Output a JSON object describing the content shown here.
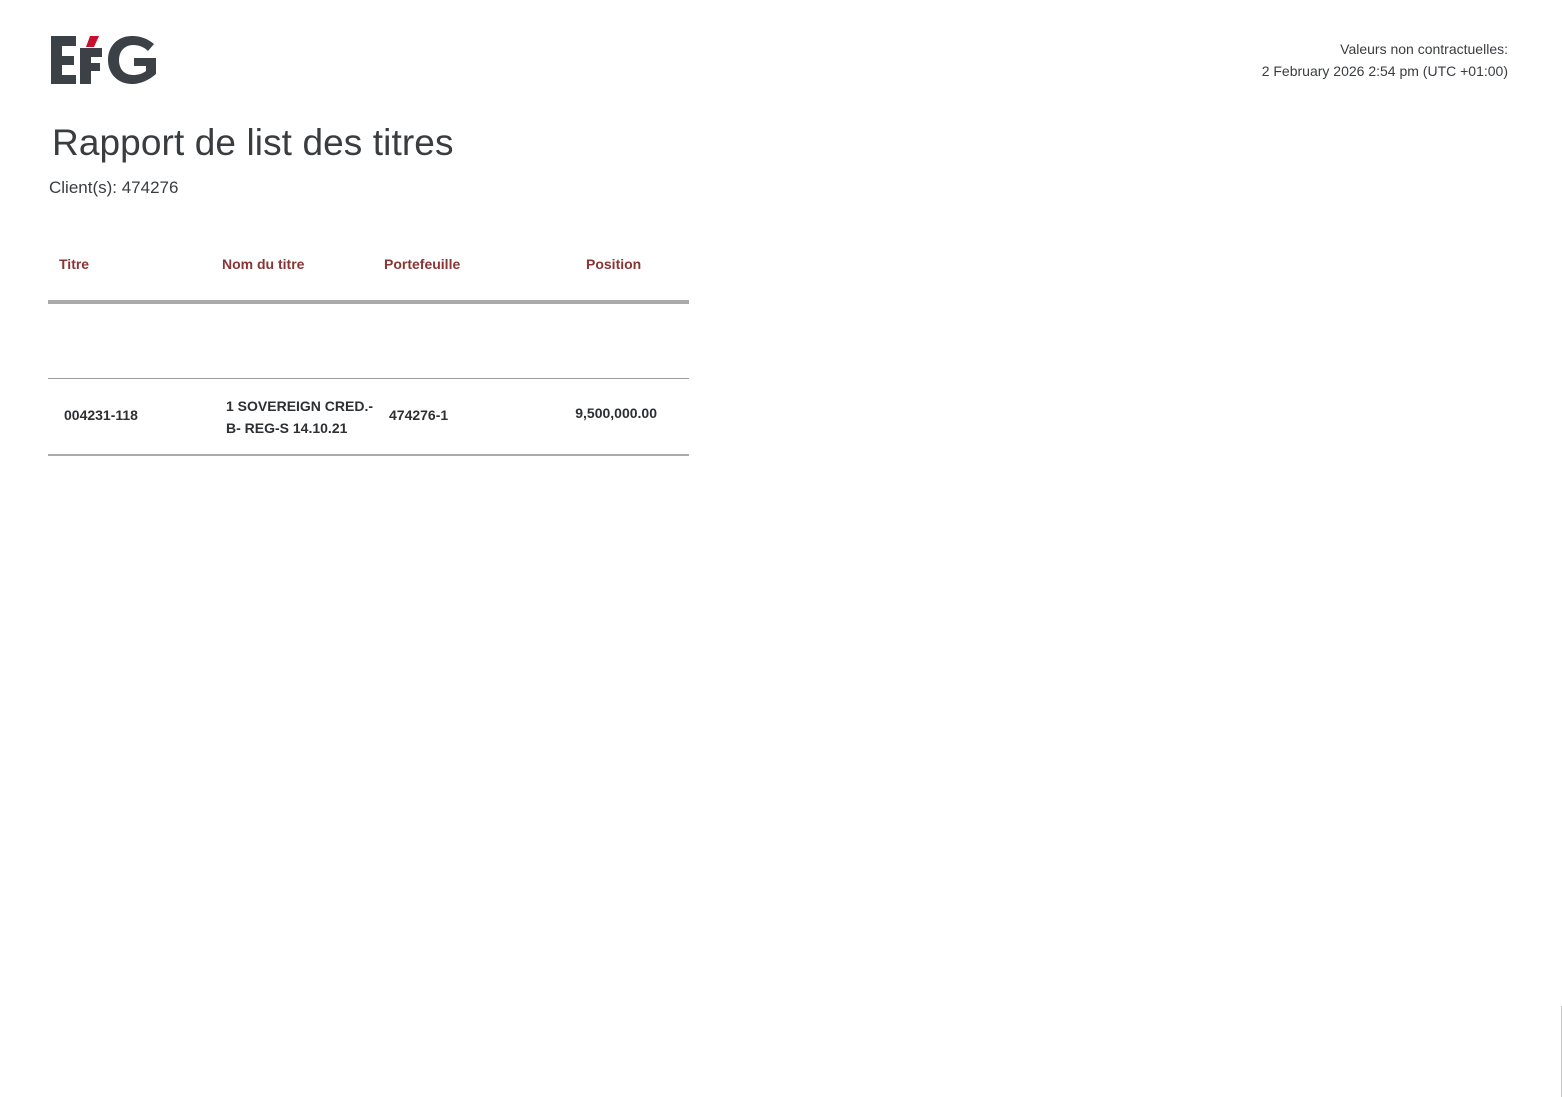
{
  "header": {
    "logo": "EFG",
    "meta_line1": "Valeurs non contractuelles:",
    "meta_line2": "2 February 2026 2:54 pm (UTC +01:00)"
  },
  "report": {
    "title": "Rapport de list des titres",
    "client_line": "Client(s): 474276"
  },
  "table": {
    "headers": {
      "titre": "Titre",
      "nom": "Nom du titre",
      "portefeuille": "Portefeuille",
      "position": "Position"
    },
    "rows": [
      {
        "titre": "004231-118",
        "nom_line1": "1 SOVEREIGN CRED.-",
        "nom_line2": "B- REG-S 14.10.21",
        "portefeuille": "474276-1",
        "position": "9,500,000.00"
      }
    ]
  },
  "colors": {
    "text": "#3a3d40",
    "header_accent": "#8a3535",
    "logo_dark": "#3b4146",
    "logo_red": "#c8102e",
    "rule": "#a8aaac"
  }
}
